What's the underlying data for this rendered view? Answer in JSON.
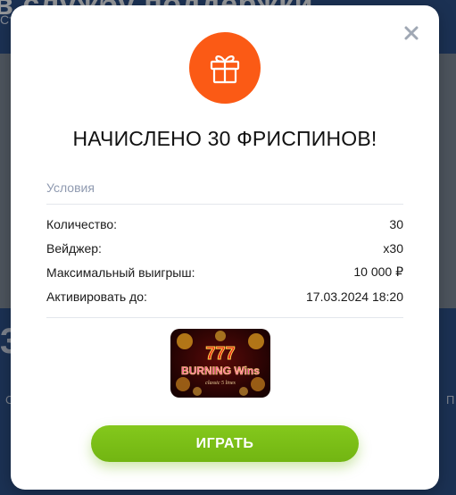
{
  "background": {
    "header_title": "в службу поддержки",
    "header_sub": "Ст",
    "side_left": "С",
    "side_right": "П",
    "glyph": "3"
  },
  "modal": {
    "close_icon": "close-icon",
    "gift_icon": "gift-icon",
    "title": "НАЧИСЛЕНО 30 ФРИСПИНОВ!",
    "conditions": {
      "heading": "Условия",
      "rows": [
        {
          "label": "Количество:",
          "value": "30"
        },
        {
          "label": "Вейджер:",
          "value": "x30"
        },
        {
          "label": "Максимальный выигрыш:",
          "value": "10 000 ₽"
        },
        {
          "label": "Активировать до:",
          "value": "17.03.2024 18:20"
        }
      ]
    },
    "game": {
      "logo_top": "777",
      "logo_name": "BURNING Wins",
      "logo_sub": "classic 5 lines"
    },
    "play_button": "ИГРАТЬ"
  },
  "colors": {
    "accent_orange": "#fb5a15",
    "play_green": "#7cc01a",
    "heading_gray": "#8f9ab0",
    "background_blue": "#22457e"
  }
}
